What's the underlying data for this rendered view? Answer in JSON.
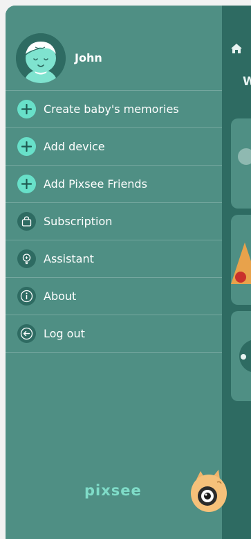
{
  "user": {
    "name": "John"
  },
  "menu": [
    {
      "label": "Create baby's memories",
      "icon": "plus-icon"
    },
    {
      "label": "Add device",
      "icon": "plus-icon"
    },
    {
      "label": "Add Pixsee Friends",
      "icon": "plus-icon"
    },
    {
      "label": "Subscription",
      "icon": "shopping-bag-icon"
    },
    {
      "label": "Assistant",
      "icon": "lightbulb-icon"
    },
    {
      "label": "About",
      "icon": "info-icon"
    },
    {
      "label": "Log out",
      "icon": "logout-icon"
    }
  ],
  "brand": "pixsee",
  "background_peek": {
    "heading_letter": "W"
  },
  "colors": {
    "drawer": "#4f8f84",
    "accent": "#68e0c9",
    "dark": "#2e6b62"
  }
}
